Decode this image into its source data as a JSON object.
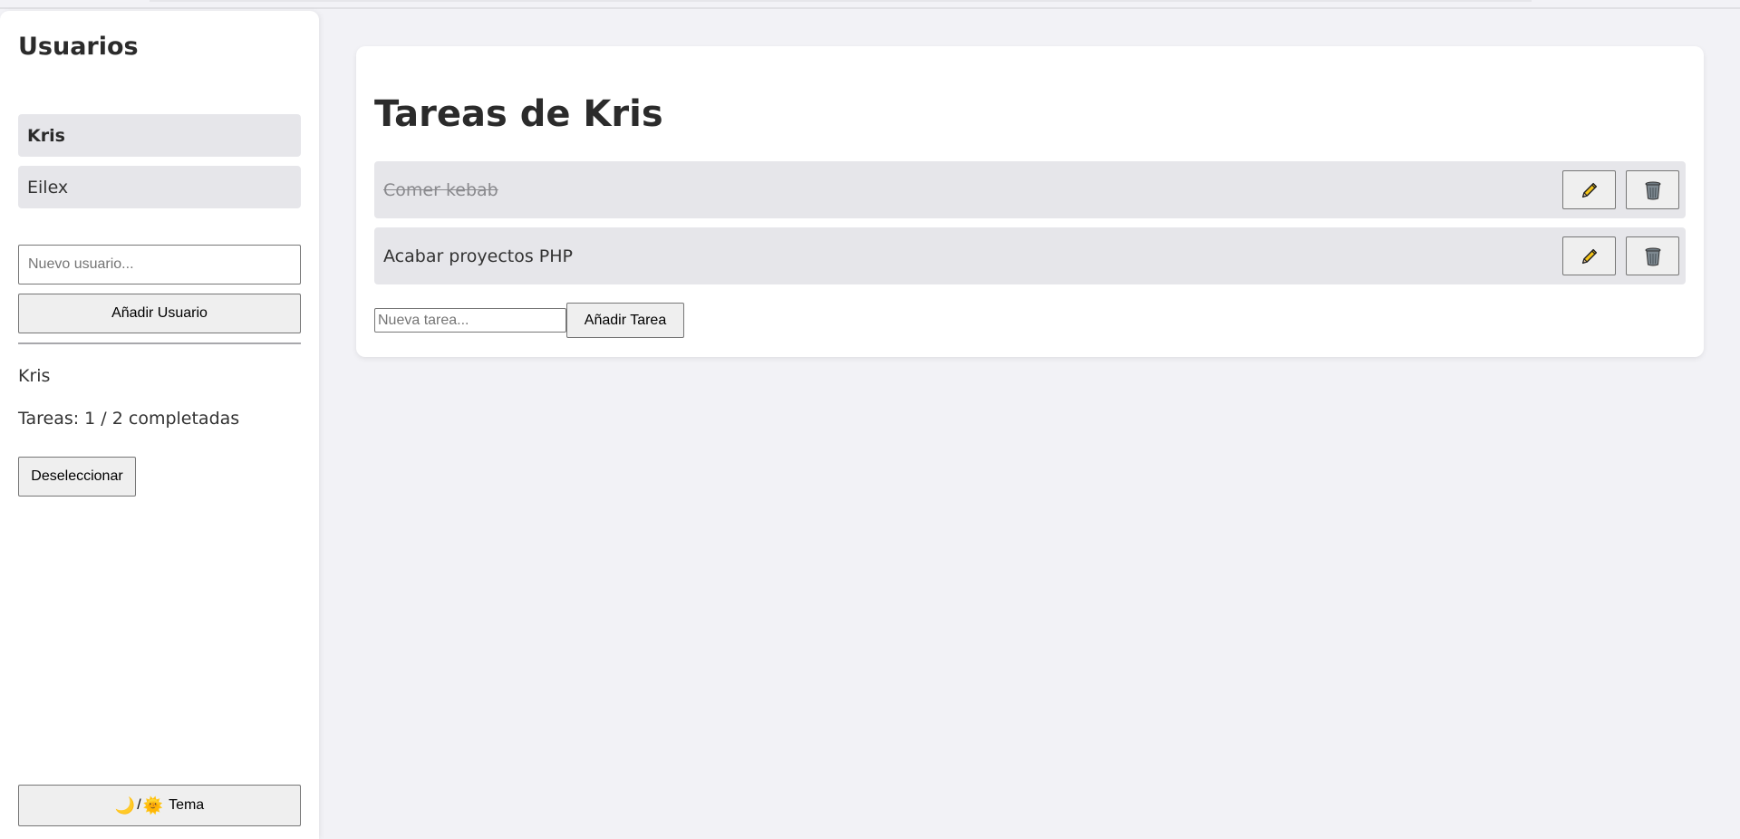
{
  "sidebar": {
    "title": "Usuarios",
    "users": [
      {
        "name": "Kris",
        "active": true
      },
      {
        "name": "Eilex",
        "active": false
      }
    ],
    "new_user_placeholder": "Nuevo usuario...",
    "add_user_label": "Añadir Usuario",
    "selected_user": "Kris",
    "task_summary": "Tareas: 1 / 2 completadas",
    "deselect_label": "Deseleccionar",
    "theme": {
      "moon_glyph": "🌙",
      "separator": "/",
      "sun_glyph": "🌞",
      "label": "Tema"
    }
  },
  "main": {
    "title": "Tareas de Kris",
    "tasks": [
      {
        "text": "Comer kebab",
        "completed": true
      },
      {
        "text": "Acabar proyectos PHP",
        "completed": false
      }
    ],
    "new_task_placeholder": "Nueva tarea...",
    "add_task_label": "Añadir Tarea",
    "icons": {
      "edit": "pencil-icon",
      "delete": "trash-icon"
    }
  },
  "colors": {
    "background": "#f2f2f6",
    "panel": "#ffffff",
    "item_bg": "#e6e6ea",
    "text": "#333333",
    "pencil": "#f5c518"
  }
}
